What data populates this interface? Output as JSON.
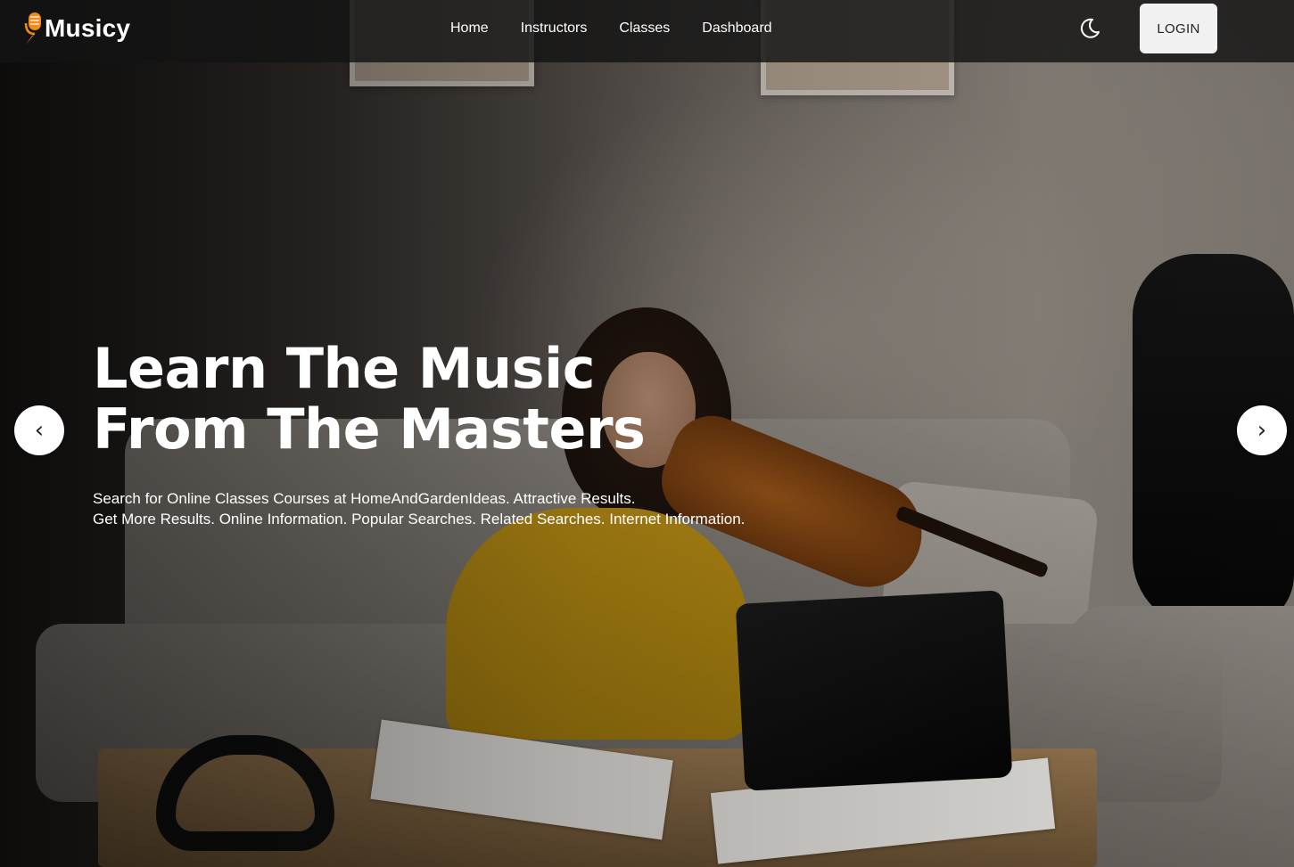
{
  "brand": {
    "name": "Musicy",
    "logo_icon": "microphone-icon",
    "accent_color": "#f28a1e"
  },
  "nav": {
    "links": [
      "Home",
      "Instructors",
      "Classes",
      "Dashboard"
    ],
    "theme_toggle_icon": "moon-icon",
    "login_label": "LOGIN"
  },
  "hero": {
    "title_lines": [
      "Learn The Music",
      "From The Masters"
    ],
    "subtitle_lines": [
      "Search for Online Classes Courses at HomeAndGardenIdeas. Attractive Results.",
      "Get More Results. Online Information. Popular Searches. Related Searches. Internet Information."
    ],
    "prev_arrow": "‹",
    "next_arrow": "›"
  }
}
